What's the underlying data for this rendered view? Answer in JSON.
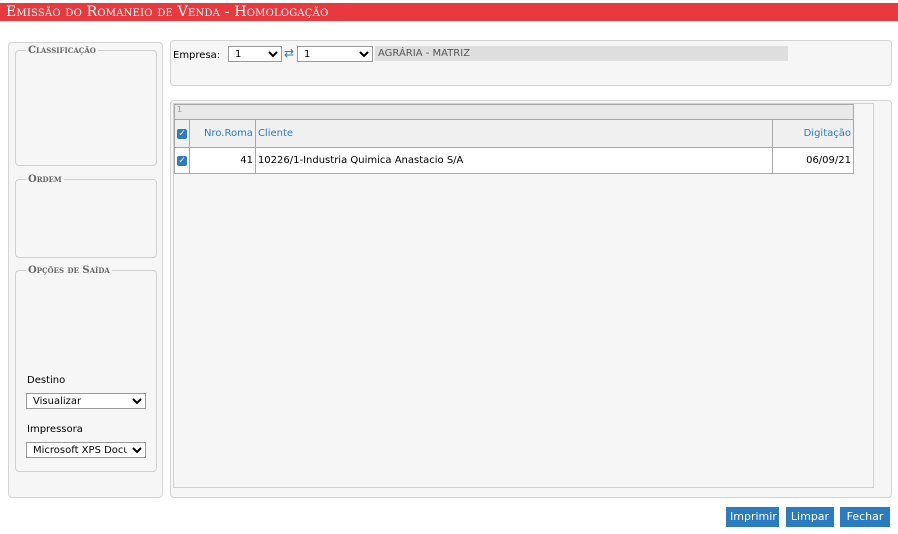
{
  "window": {
    "title": "Emissão do Romaneio de Venda   - Homologação"
  },
  "sidebar": {
    "classificacao_legend": "Classificação",
    "ordem_legend": "Ordem",
    "opcoes_legend": "Opções de Saída",
    "destino_label": "Destino",
    "destino_value": "Visualizar",
    "impressora_label": "Impressora",
    "impressora_value": "Microsoft XPS Docu"
  },
  "filter": {
    "empresa_label": "Empresa:",
    "empresa_value_1": "1",
    "empresa_value_2": "1",
    "empresa_name": "AGRÁRIA - MATRIZ"
  },
  "grid": {
    "page_indicator": "1",
    "columns": {
      "nro_roma": "Nro.Roma",
      "cliente": "Cliente",
      "digitacao": "Digitação"
    },
    "rows": [
      {
        "checked": true,
        "nro_roma": "41",
        "cliente": "10226/1-Industria Quimica Anastacio S/A",
        "digitacao": "06/09/21"
      }
    ]
  },
  "buttons": {
    "imprimir": "Imprimir",
    "limpar": "Limpar",
    "fechar": "Fechar"
  },
  "colors": {
    "title_bar": "#e8393f",
    "accent": "#2a7bc0"
  },
  "icons": {
    "sync": "sync-icon",
    "checkbox": "checkbox-checked-icon"
  }
}
